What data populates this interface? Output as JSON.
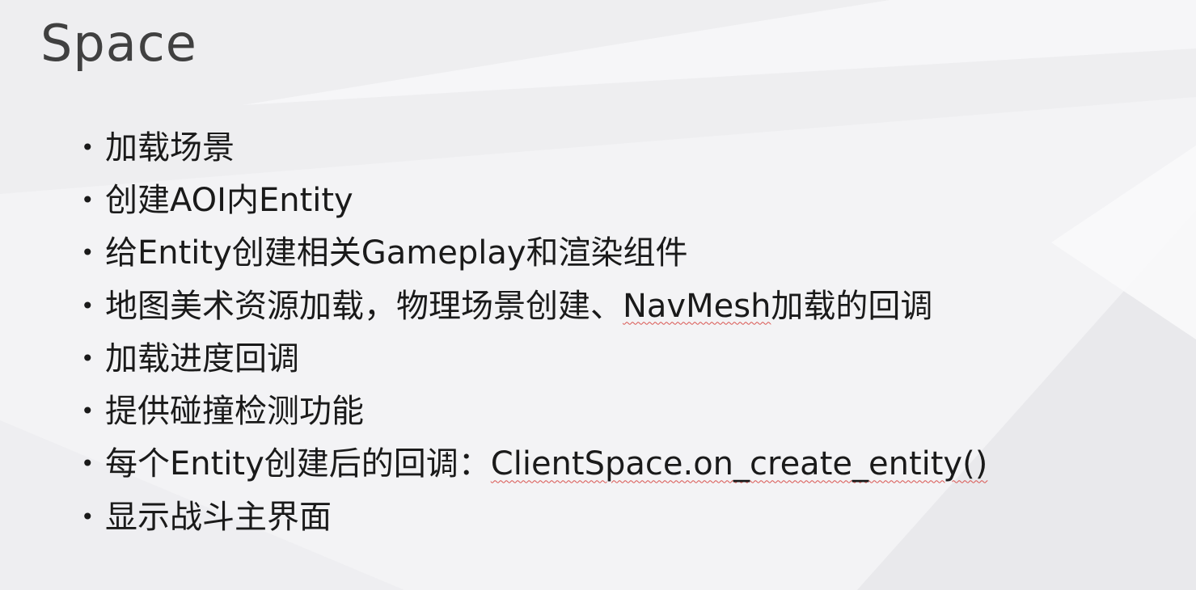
{
  "slide": {
    "title": "Space",
    "bullet_symbol": "•",
    "bullets": [
      {
        "text": "加载场景"
      },
      {
        "text": "创建AOI内Entity"
      },
      {
        "text": "给Entity创建相关Gameplay和渲染组件"
      },
      {
        "prefix": "地图美术资源加载，物理场景创建、",
        "flagged": "NavMesh",
        "suffix": "加载的回调"
      },
      {
        "text": "加载进度回调"
      },
      {
        "text": "提供碰撞检测功能"
      },
      {
        "prefix": "每个Entity创建后的回调：",
        "flagged": "ClientSpace.on_create_entity()"
      },
      {
        "text": "显示战斗主界面"
      }
    ]
  },
  "colors": {
    "background": "#f2f2f4",
    "title": "#404040",
    "text": "#1a1a1a",
    "spellcheck_underline": "#d9534f"
  }
}
